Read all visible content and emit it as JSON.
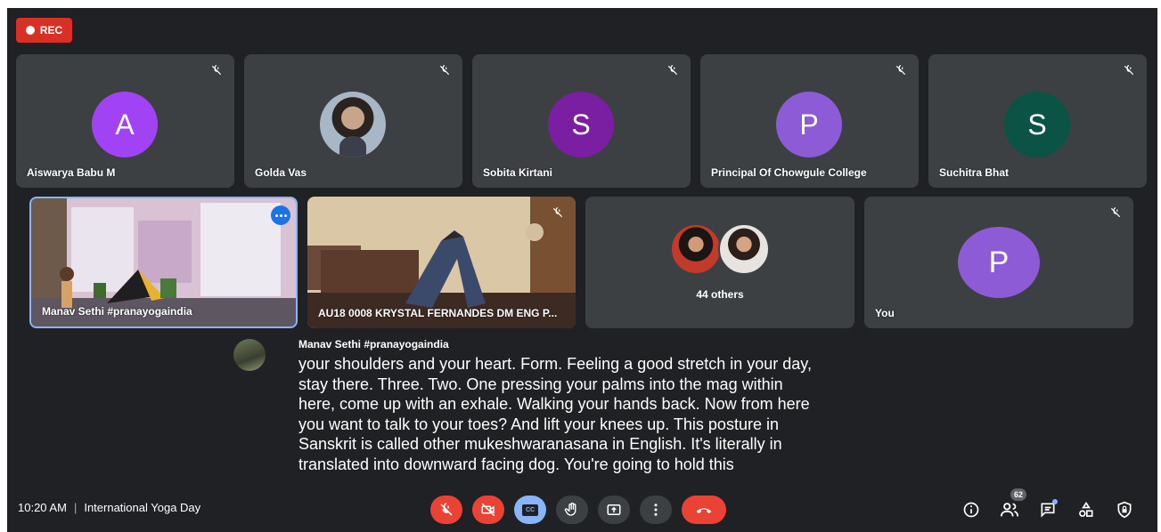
{
  "recording": {
    "label": "REC"
  },
  "colors": {
    "background": "#202124",
    "tile": "#3c4043",
    "danger": "#ea4335",
    "accent": "#8ab4f8",
    "avatar_purple_light": "#a142f4",
    "avatar_purple_dark": "#7b1fa2",
    "avatar_violet": "#8e5bd6",
    "avatar_teal": "#0b5345"
  },
  "row1": [
    {
      "name": "Aiswarya Babu M",
      "initial": "A",
      "muted": true
    },
    {
      "name": "Golda Vas",
      "initial": "",
      "muted": true
    },
    {
      "name": "Sobita Kirtani",
      "initial": "S",
      "muted": true
    },
    {
      "name": "Principal Of Chowgule College",
      "initial": "P",
      "muted": true
    },
    {
      "name": "Suchitra Bhat",
      "initial": "S",
      "muted": true
    }
  ],
  "row2": [
    {
      "name": "Manav Sethi #pranayogaindia",
      "type": "video",
      "pinned": true
    },
    {
      "name": "AU18 0008 KRYSTAL FERNANDES DM ENG P...",
      "type": "video",
      "muted": true
    },
    {
      "name": "44 others",
      "type": "group"
    },
    {
      "name": "You",
      "initial": "P",
      "type": "avatar",
      "muted": true
    }
  ],
  "caption": {
    "speaker": "Manav Sethi #pranayogaindia",
    "lines": [
      "your shoulders and your heart. Form. Feeling a good stretch in your day,",
      "stay there. Three. Two. One pressing your palms into the mag within",
      "here, come up with an exhale. Walking your hands back. Now from here",
      "you want to talk to your toes? And lift your knees up. This posture in",
      "Sanskrit is called other mukeshwaranasana in English. It's literally in",
      "translated into downward facing dog. You're going to hold this"
    ]
  },
  "footer": {
    "time": "10:20 AM",
    "separator": "|",
    "meeting_title": "International Yoga Day",
    "participants_count": "62"
  },
  "controls": [
    {
      "name": "mic-off",
      "icon": "mic-off-icon"
    },
    {
      "name": "camera-off",
      "icon": "camera-off-icon"
    },
    {
      "name": "captions",
      "icon": "closed-captions-icon",
      "label": "CC"
    },
    {
      "name": "raise-hand",
      "icon": "hand-icon"
    },
    {
      "name": "present",
      "icon": "present-screen-icon"
    },
    {
      "name": "more-options",
      "icon": "more-vert-icon"
    },
    {
      "name": "leave-call",
      "icon": "phone-hangup-icon"
    }
  ],
  "right_controls": [
    {
      "name": "meeting-details",
      "icon": "info-icon"
    },
    {
      "name": "people",
      "icon": "people-icon"
    },
    {
      "name": "chat",
      "icon": "chat-icon"
    },
    {
      "name": "activities",
      "icon": "activities-icon"
    },
    {
      "name": "host-controls",
      "icon": "shield-lock-icon"
    }
  ]
}
